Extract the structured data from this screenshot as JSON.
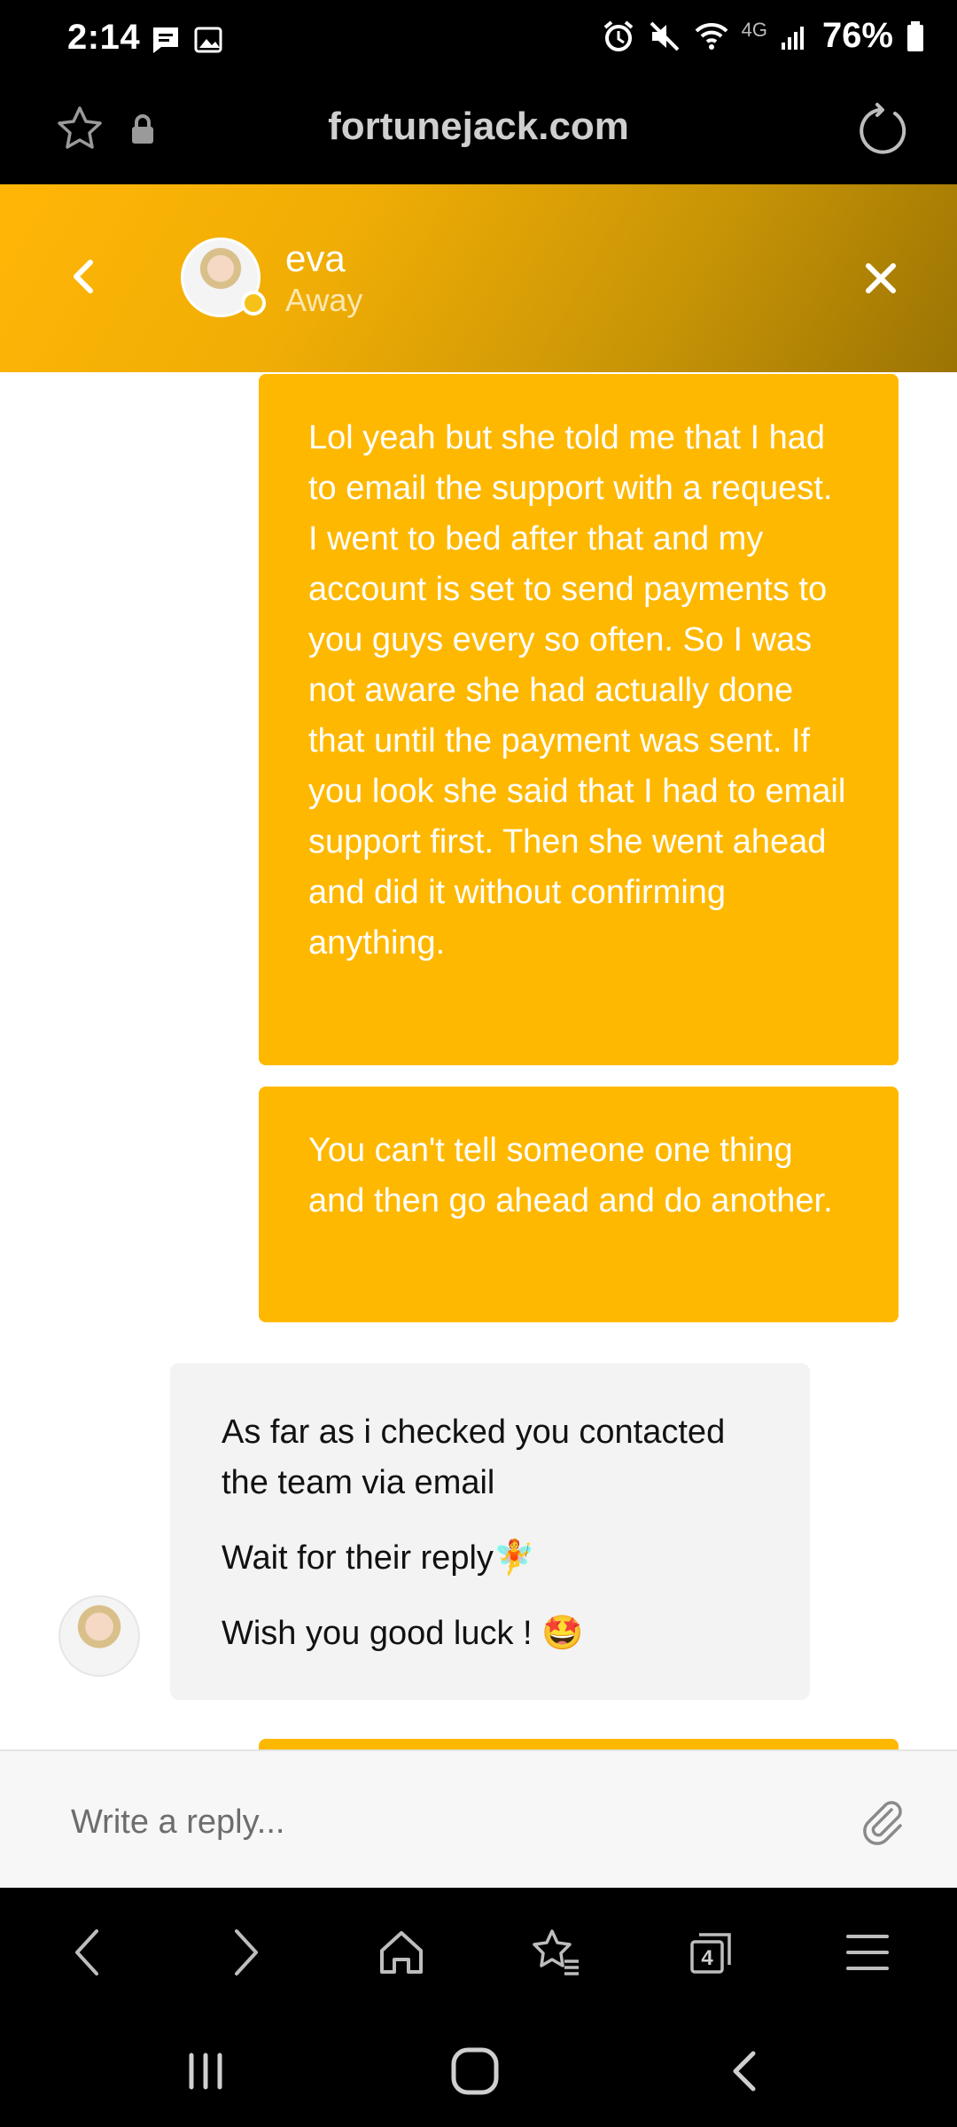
{
  "status_bar": {
    "time": "2:14",
    "battery_percent": "76%",
    "network_label": "4G",
    "icons": [
      "message-icon",
      "image-icon",
      "alarm-icon",
      "mute-icon",
      "wifi-icon",
      "signal-icon",
      "battery-icon"
    ]
  },
  "browser": {
    "url": "fortunejack.com",
    "tab_count": "4"
  },
  "chat_header": {
    "agent_name": "eva",
    "agent_status": "Away",
    "accent": "#ffb800"
  },
  "messages": [
    {
      "from": "user",
      "text": "Lol yeah but she told me that I had to email the support with a request. I went to bed after that and my account is set to send payments to you guys every so often. So I was not aware she had actually done that until the payment was sent. If you look she said that I had to email support first. Then she went ahead and did it without confirming anything."
    },
    {
      "from": "user",
      "text": "You can't tell someone one thing and then go ahead and do another."
    },
    {
      "from": "agent",
      "lines": [
        "As far as i checked you contacted the team via email",
        "Wait for their reply🧚",
        "Wish you good luck ! 🤩"
      ]
    }
  ],
  "reply": {
    "placeholder": "Write a reply..."
  }
}
